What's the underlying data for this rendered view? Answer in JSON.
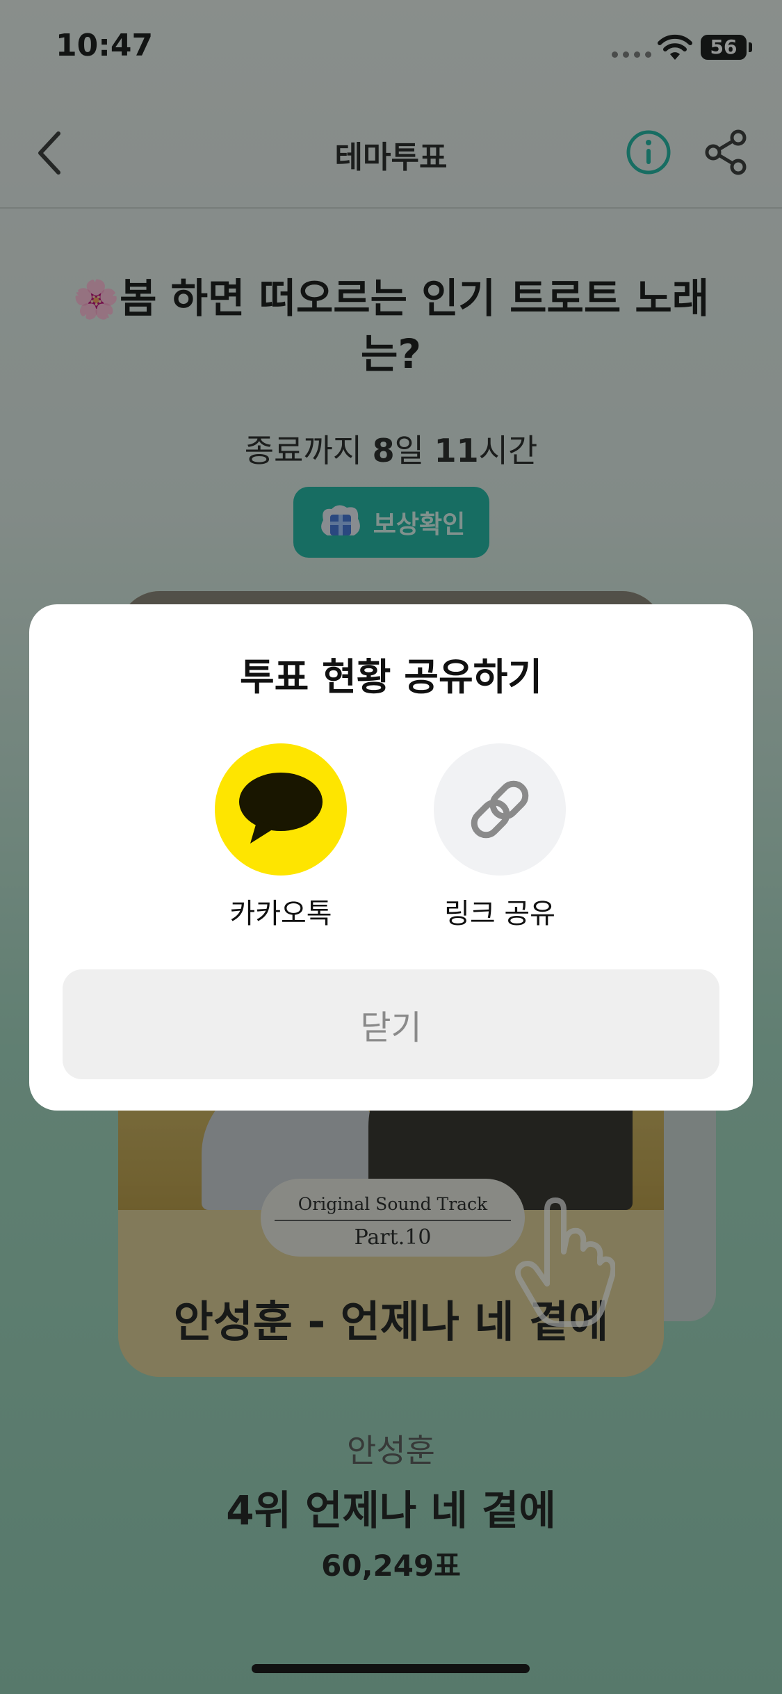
{
  "status_bar": {
    "time": "10:47",
    "battery": "56"
  },
  "nav": {
    "title": "테마투표",
    "back_icon": "chevron-left-icon",
    "info_icon": "info-icon",
    "share_icon": "share-icon",
    "accent_color": "#1ab3a0"
  },
  "vote": {
    "title_emoji": "🌸",
    "title": "봄 하면 떠오르는 인기 트로트 노래는?",
    "countdown_prefix": "종료까지 ",
    "countdown_days": "8",
    "countdown_days_unit": "일 ",
    "countdown_hours": "11",
    "countdown_hours_unit": "시간",
    "reward_label": "보상확인"
  },
  "album": {
    "ost_line1": "Original Sound Track",
    "ost_line2": "Part.10",
    "caption": "안성훈 - 언제나 네 곁에"
  },
  "song": {
    "artist": "안성훈",
    "rank_title": "4위 언제나 네 곁에",
    "votes": "60,249표"
  },
  "share_modal": {
    "title": "투표 현황 공유하기",
    "options": [
      {
        "label": "카카오톡",
        "icon": "kakaotalk-icon",
        "color": "#fee500"
      },
      {
        "label": "링크 공유",
        "icon": "link-icon",
        "color": "#f1f2f4"
      }
    ],
    "close_label": "닫기"
  }
}
